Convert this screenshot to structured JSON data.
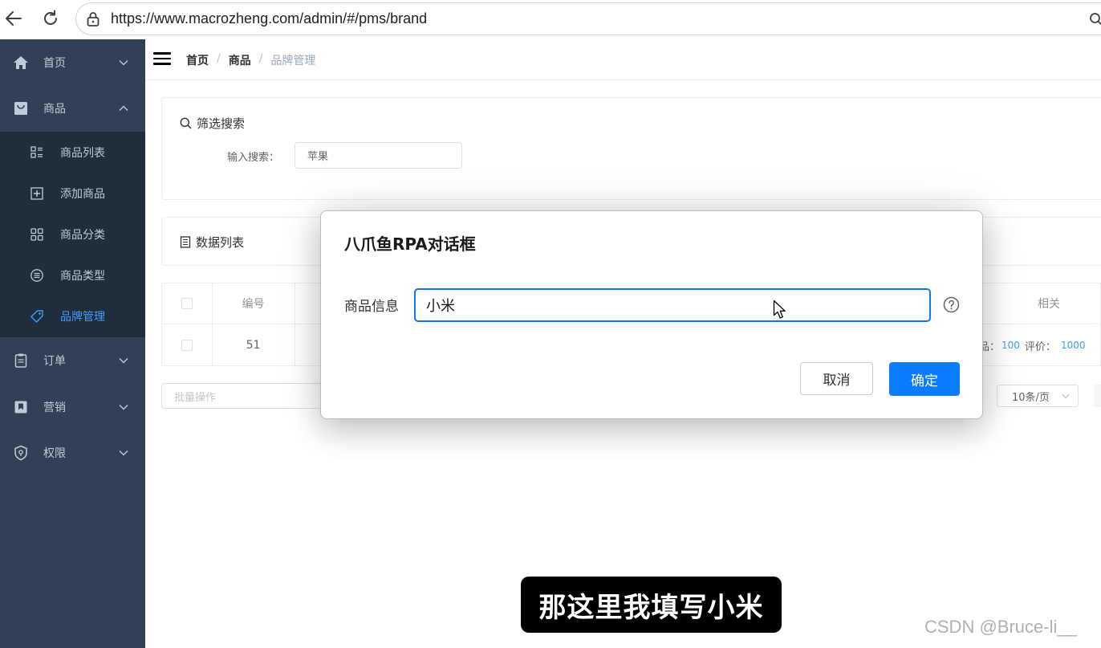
{
  "browser": {
    "url": "https://www.macrozheng.com/admin/#/pms/brand"
  },
  "sidebar": {
    "items": [
      {
        "label": "首页",
        "icon": "home-icon"
      },
      {
        "label": "商品",
        "icon": "shopping-bag-icon"
      },
      {
        "label": "订单",
        "icon": "clipboard-icon"
      },
      {
        "label": "营销",
        "icon": "bookmark-icon"
      },
      {
        "label": "权限",
        "icon": "shield-icon"
      }
    ],
    "sub_items": [
      {
        "label": "商品列表",
        "icon": "list-icon"
      },
      {
        "label": "添加商品",
        "icon": "add-box-icon"
      },
      {
        "label": "商品分类",
        "icon": "grid-icon"
      },
      {
        "label": "商品类型",
        "icon": "lines-circle-icon"
      },
      {
        "label": "品牌管理",
        "icon": "tag-icon",
        "active": true
      }
    ]
  },
  "header": {
    "breadcrumb": [
      "首页",
      "商品",
      "品牌管理"
    ],
    "separator": "/"
  },
  "filter": {
    "title": "筛选搜索",
    "label": "输入搜索：",
    "value": "苹果"
  },
  "list": {
    "title": "数据列表"
  },
  "table": {
    "headers": {
      "id": "编号",
      "related": "相关"
    },
    "row": {
      "id": "51",
      "related_prefix": "商品：",
      "related_products": "100",
      "related_review_label": "评价：",
      "related_reviews": "1000"
    }
  },
  "footer": {
    "batch_placeholder": "批量操作",
    "page_size": "10条/页"
  },
  "dialog": {
    "title": "八爪鱼RPA对话框",
    "label": "商品信息",
    "value": "小米",
    "cancel": "取消",
    "ok": "确定"
  },
  "overlay": {
    "subtitle": "那这里我填写小米",
    "watermark": "CSDN @Bruce-li__"
  },
  "colors": {
    "sidebar_bg": "#304156",
    "submenu_bg": "#1f2d3d",
    "accent": "#409eff",
    "primary_button": "#0a7cff"
  }
}
